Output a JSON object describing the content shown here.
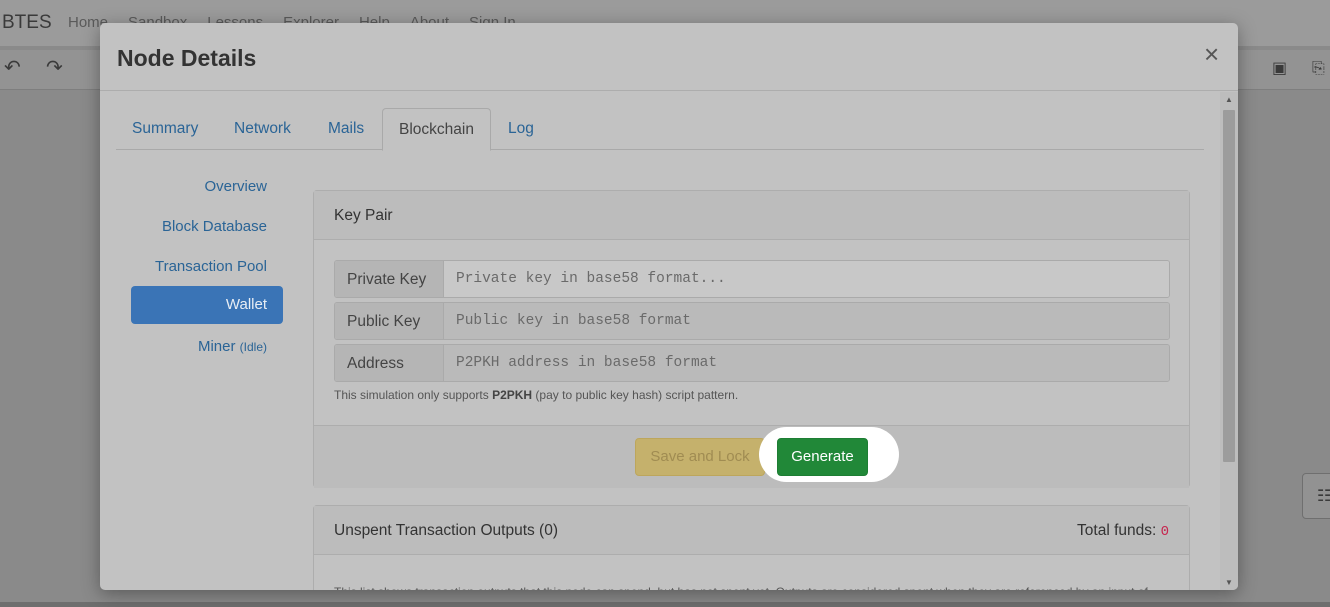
{
  "app": {
    "brand": "BTES",
    "nav": [
      "Home",
      "Sandbox",
      "Lessons",
      "Explorer",
      "Help",
      "About",
      "Sign In"
    ]
  },
  "modal": {
    "title": "Node Details",
    "close": "×",
    "tabs": [
      "Summary",
      "Network",
      "Mails",
      "Blockchain",
      "Log"
    ],
    "active_tab": "Blockchain",
    "side_nav": {
      "overview": "Overview",
      "block_database": "Block Database",
      "transaction_pool": "Transaction Pool",
      "wallet": "Wallet",
      "miner": "Miner",
      "miner_status": "(Idle)"
    }
  },
  "key_pair": {
    "title": "Key Pair",
    "private_key": {
      "label": "Private Key",
      "placeholder": "Private key in base58 format..."
    },
    "public_key": {
      "label": "Public Key",
      "placeholder": "Public key in base58 format"
    },
    "address": {
      "label": "Address",
      "placeholder": "P2PKH address in base58 format"
    },
    "help_prefix": "This simulation only supports ",
    "help_bold": "P2PKH",
    "help_suffix": " (pay to public key hash) script pattern.",
    "save_button": "Save and Lock",
    "generate_button": "Generate"
  },
  "utxo": {
    "title": "Unspent Transaction Outputs (0)",
    "funds_label": "Total funds: ",
    "funds_value": "0",
    "description": "This list shows transaction outputs that this node can spend, but has not spent yet. Outputs are considered spent when they are referenced by an input of another valid transaction."
  },
  "colors": {
    "accent": "#3a74b6",
    "generate": "#218838",
    "save_and_lock": "#c5b16c",
    "funds_value": "#c7254e"
  },
  "icons": {
    "undo": "undo-icon",
    "redo": "redo-icon",
    "save": "save-icon",
    "export": "export-icon",
    "network": "network-icon"
  }
}
